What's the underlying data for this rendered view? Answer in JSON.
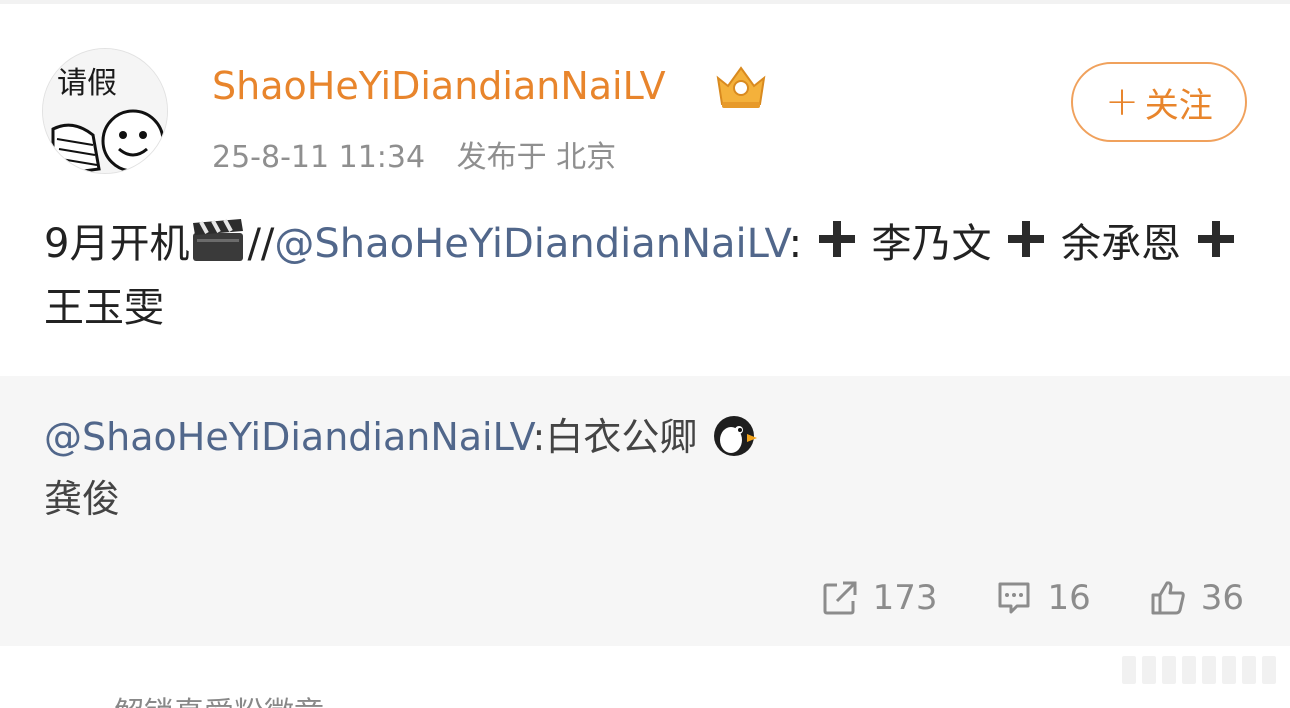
{
  "post": {
    "author": {
      "name": "ShaoHeYiDiandianNaiLV",
      "avatar_text": "请假",
      "badge_icon": "crown-icon"
    },
    "time": "25-8-11 11:34",
    "location": "发布于 北京",
    "follow_label": "关注",
    "text": {
      "part1": "9月开机",
      "part2": "//",
      "mention": "@ShaoHeYiDiandianNaiLV",
      "colon": ":",
      "names": [
        "李乃文",
        "余承恩",
        "王玉雯"
      ]
    }
  },
  "repost": {
    "mention": "@ShaoHeYiDiandianNaiLV",
    "text": ":白衣公卿",
    "line2": "龚俊"
  },
  "actions": {
    "share_count": "173",
    "comment_count": "16",
    "like_count": "36"
  },
  "footer": {
    "badge_text": "解锁真爱粉徽章"
  },
  "colors": {
    "accent": "#e8852c",
    "mention": "#51678b",
    "repost_bg": "#f6f6f6"
  }
}
